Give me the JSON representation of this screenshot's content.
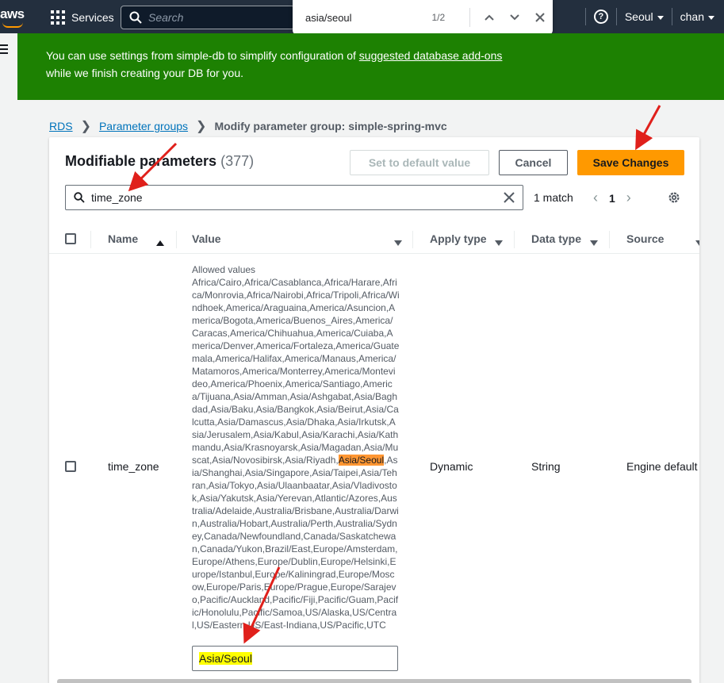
{
  "topnav": {
    "logo": "aws",
    "services_label": "Services",
    "search_placeholder": "Search",
    "region": "Seoul",
    "user": "chan",
    "help_glyph": "?"
  },
  "findbar": {
    "query": "asia/seoul",
    "count": "1/2"
  },
  "banner": {
    "text_before": "You can use settings from simple-db to simplify configuration of ",
    "link": "suggested database add-ons",
    "text_after": " while we finish creating your DB for you."
  },
  "breadcrumb": {
    "items": [
      "RDS",
      "Parameter groups"
    ],
    "current": "Modify parameter group: simple-spring-mvc"
  },
  "card": {
    "title": "Modifiable parameters",
    "count": "(377)",
    "set_default_label": "Set to default value",
    "cancel_label": "Cancel",
    "save_label": "Save Changes",
    "filter_value": "time_zone",
    "match_text": "1 match",
    "page": "1"
  },
  "table": {
    "headers": [
      "Name",
      "Value",
      "Apply type",
      "Data type",
      "Source"
    ],
    "row": {
      "name": "time_zone",
      "allowed_label": "Allowed values",
      "allowed_before": "Africa/Cairo,Africa/Casablanca,Africa/Harare,Africa/Monrovia,Africa/Nairobi,Africa/Tripoli,Africa/Windhoek,America/Araguaina,America/Asuncion,America/Bogota,America/Buenos_Aires,America/Caracas,America/Chihuahua,America/Cuiaba,America/Denver,America/Fortaleza,America/Guatemala,America/Halifax,America/Manaus,America/Matamoros,America/Monterrey,America/Montevideo,America/Phoenix,America/Santiago,America/Tijuana,Asia/Amman,Asia/Ashgabat,Asia/Baghdad,Asia/Baku,Asia/Bangkok,Asia/Beirut,Asia/Calcutta,Asia/Damascus,Asia/Dhaka,Asia/Irkutsk,Asia/Jerusalem,Asia/Kabul,Asia/Karachi,Asia/Kathmandu,Asia/Krasnoyarsk,Asia/Magadan,Asia/Muscat,Asia/Novosibirsk,Asia/Riyadh,",
      "allowed_match": "Asia/Seoul",
      "allowed_after": ",Asia/Shanghai,Asia/Singapore,Asia/Taipei,Asia/Tehran,Asia/Tokyo,Asia/Ulaanbaatar,Asia/Vladivostok,Asia/Yakutsk,Asia/Yerevan,Atlantic/Azores,Australia/Adelaide,Australia/Brisbane,Australia/Darwin,Australia/Hobart,Australia/Perth,Australia/Sydney,Canada/Newfoundland,Canada/Saskatchewan,Canada/Yukon,Brazil/East,Europe/Amsterdam,Europe/Athens,Europe/Dublin,Europe/Helsinki,Europe/Istanbul,Europe/Kaliningrad,Europe/Moscow,Europe/Paris,Europe/Prague,Europe/Sarajevo,Pacific/Auckland,Pacific/Fiji,Pacific/Guam,Pacific/Honolulu,Pacific/Samoa,US/Alaska,US/Central,US/Eastern,US/East-Indiana,US/Pacific,UTC",
      "value": "Asia/Seoul",
      "apply_type": "Dynamic",
      "data_type": "String",
      "source": "Engine default"
    }
  },
  "colors": {
    "nav_bg": "#232f3e",
    "banner_green": "#1d8102",
    "primary_orange": "#ff9900",
    "link_blue": "#0073bb",
    "annotation_red": "#e0201b",
    "find_highlight": "#ff9632",
    "value_highlight": "#ffff00"
  }
}
